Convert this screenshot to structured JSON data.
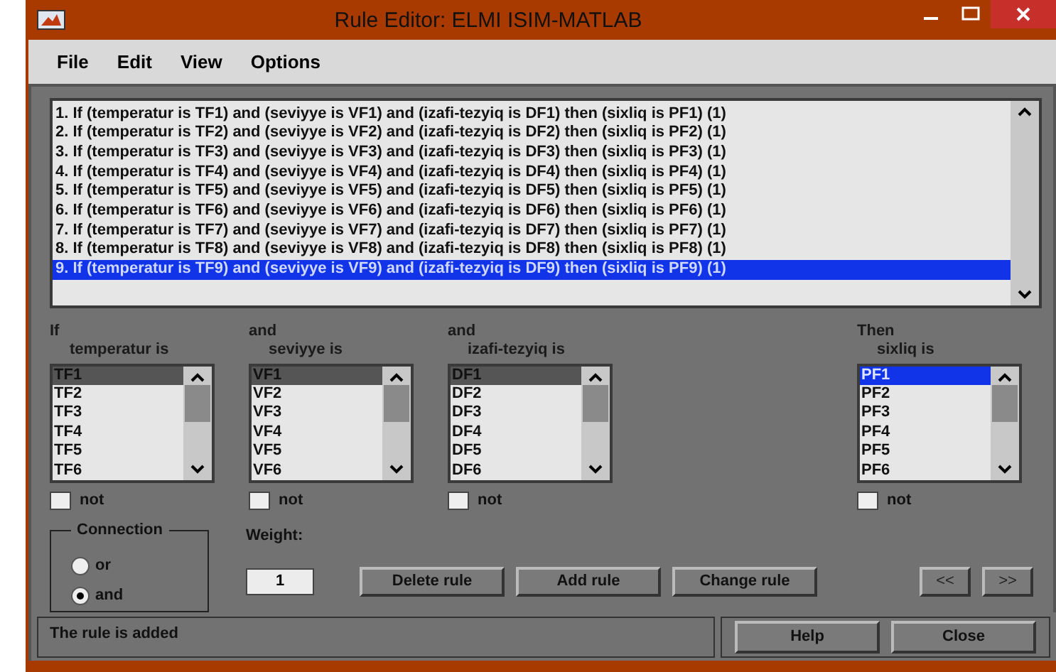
{
  "window": {
    "title": "Rule Editor: ELMI ISIM-MATLAB"
  },
  "menu": [
    "File",
    "Edit",
    "View",
    "Options"
  ],
  "rules": [
    {
      "text": "1. If (temperatur is TF1) and (seviyye is VF1) and (izafi-tezyiq is DF1) then (sixliq is PF1) (1)",
      "selected": false
    },
    {
      "text": "2. If (temperatur is TF2) and (seviyye is VF2) and (izafi-tezyiq is DF2) then (sixliq is PF2) (1)",
      "selected": false
    },
    {
      "text": "3. If (temperatur is TF3) and (seviyye is VF3) and (izafi-tezyiq is DF3) then (sixliq is PF3) (1)",
      "selected": false
    },
    {
      "text": "4. If (temperatur is TF4) and (seviyye is VF4) and (izafi-tezyiq is DF4) then (sixliq is PF4) (1)",
      "selected": false
    },
    {
      "text": "5. If (temperatur is TF5) and (seviyye is VF5) and (izafi-tezyiq is DF5) then (sixliq is PF5) (1)",
      "selected": false
    },
    {
      "text": "6. If (temperatur is TF6) and (seviyye is VF6) and (izafi-tezyiq is DF6) then (sixliq is PF6) (1)",
      "selected": false
    },
    {
      "text": "7. If (temperatur is TF7) and (seviyye is VF7) and (izafi-tezyiq is DF7) then (sixliq is PF7) (1)",
      "selected": false
    },
    {
      "text": "8. If (temperatur is TF8) and (seviyye is VF8) and (izafi-tezyiq is DF8) then (sixliq is PF8) (1)",
      "selected": false
    },
    {
      "text": "9. If (temperatur is TF9) and (seviyye is VF9) and (izafi-tezyiq is DF9) then (sixliq is PF9) (1)",
      "selected": true
    }
  ],
  "columns": [
    {
      "connector": "If",
      "variable": "temperatur is",
      "focused": false,
      "not_label": "not",
      "not_checked": false,
      "items": [
        {
          "label": "TF1",
          "selected": true
        },
        {
          "label": "TF2",
          "selected": false
        },
        {
          "label": "TF3",
          "selected": false
        },
        {
          "label": "TF4",
          "selected": false
        },
        {
          "label": "TF5",
          "selected": false
        },
        {
          "label": "TF6",
          "selected": false
        }
      ]
    },
    {
      "connector": "and",
      "variable": "seviyye is",
      "focused": false,
      "not_label": "not",
      "not_checked": false,
      "items": [
        {
          "label": "VF1",
          "selected": true
        },
        {
          "label": "VF2",
          "selected": false
        },
        {
          "label": "VF3",
          "selected": false
        },
        {
          "label": "VF4",
          "selected": false
        },
        {
          "label": "VF5",
          "selected": false
        },
        {
          "label": "VF6",
          "selected": false
        }
      ]
    },
    {
      "connector": "and",
      "variable": "izafi-tezyiq is",
      "focused": false,
      "not_label": "not",
      "not_checked": false,
      "items": [
        {
          "label": "DF1",
          "selected": true
        },
        {
          "label": "DF2",
          "selected": false
        },
        {
          "label": "DF3",
          "selected": false
        },
        {
          "label": "DF4",
          "selected": false
        },
        {
          "label": "DF5",
          "selected": false
        },
        {
          "label": "DF6",
          "selected": false
        }
      ]
    },
    {
      "connector": "Then",
      "variable": "sixliq is",
      "focused": true,
      "not_label": "not",
      "not_checked": false,
      "items": [
        {
          "label": "PF1",
          "selected": true
        },
        {
          "label": "PF2",
          "selected": false
        },
        {
          "label": "PF3",
          "selected": false
        },
        {
          "label": "PF4",
          "selected": false
        },
        {
          "label": "PF5",
          "selected": false
        },
        {
          "label": "PF6",
          "selected": false
        }
      ]
    }
  ],
  "connection": {
    "title": "Connection",
    "options": [
      {
        "label": "or",
        "selected": false
      },
      {
        "label": "and",
        "selected": true
      }
    ]
  },
  "weight": {
    "label": "Weight:",
    "value": "1"
  },
  "rule_buttons": [
    "Delete rule",
    "Add rule",
    "Change rule"
  ],
  "nav_buttons": [
    "<<",
    ">>"
  ],
  "status": "The rule is added",
  "dialog_buttons": [
    "Help",
    "Close"
  ]
}
